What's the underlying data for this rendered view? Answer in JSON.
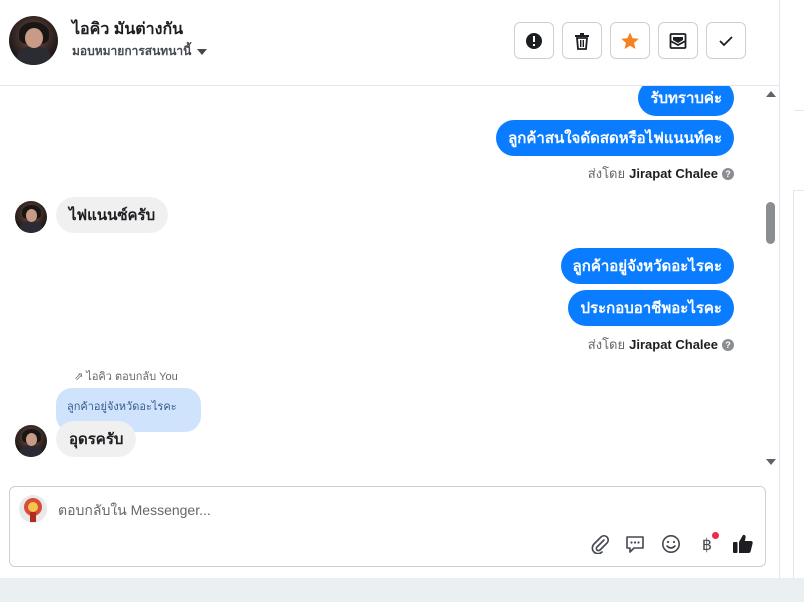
{
  "header": {
    "contact_name": "ไอคิว มันต่างกัน",
    "assign_label": "มอบหมายการสนทนานี้",
    "buttons": {
      "spam": "exclamation-icon",
      "delete": "trash-icon",
      "star": "star-icon",
      "mark_unread": "envelope-icon",
      "done": "check-icon"
    },
    "star_color": "#f58220"
  },
  "conversation": {
    "messages": [
      {
        "direction": "out",
        "text": "รับทราบค่ะ"
      },
      {
        "direction": "out",
        "text": "ลูกค้าสนใจดัดสดหรือไฟแนนท์คะ"
      },
      {
        "direction": "meta",
        "text_prefix": "ส่งโดย",
        "agent": "Jirapat Chalee"
      },
      {
        "direction": "in",
        "text": "ไฟแนนซ์ครับ"
      },
      {
        "direction": "out",
        "text": "ลูกค้าอยู่จังหวัดอะไรคะ"
      },
      {
        "direction": "out",
        "text": "ประกอบอาชีพอะไรคะ"
      },
      {
        "direction": "meta",
        "text_prefix": "ส่งโดย",
        "agent": "Jirapat Chalee"
      },
      {
        "direction": "in",
        "reply_label": "ไอคิว ตอบกลับ You",
        "quoted": "ลูกค้าอยู่จังหวัดอะไรคะ",
        "text": "อุดรครับ"
      }
    ],
    "outgoing_color": "#0a7cff",
    "incoming_color": "#f0f0f0"
  },
  "composer": {
    "placeholder": "ตอบกลับใน Messenger...",
    "value": "",
    "tools": [
      "paperclip-icon",
      "saved-reply-icon",
      "emoji-icon",
      "baht-icon",
      "thumbs-up-icon"
    ],
    "baht_symbol": "฿"
  }
}
